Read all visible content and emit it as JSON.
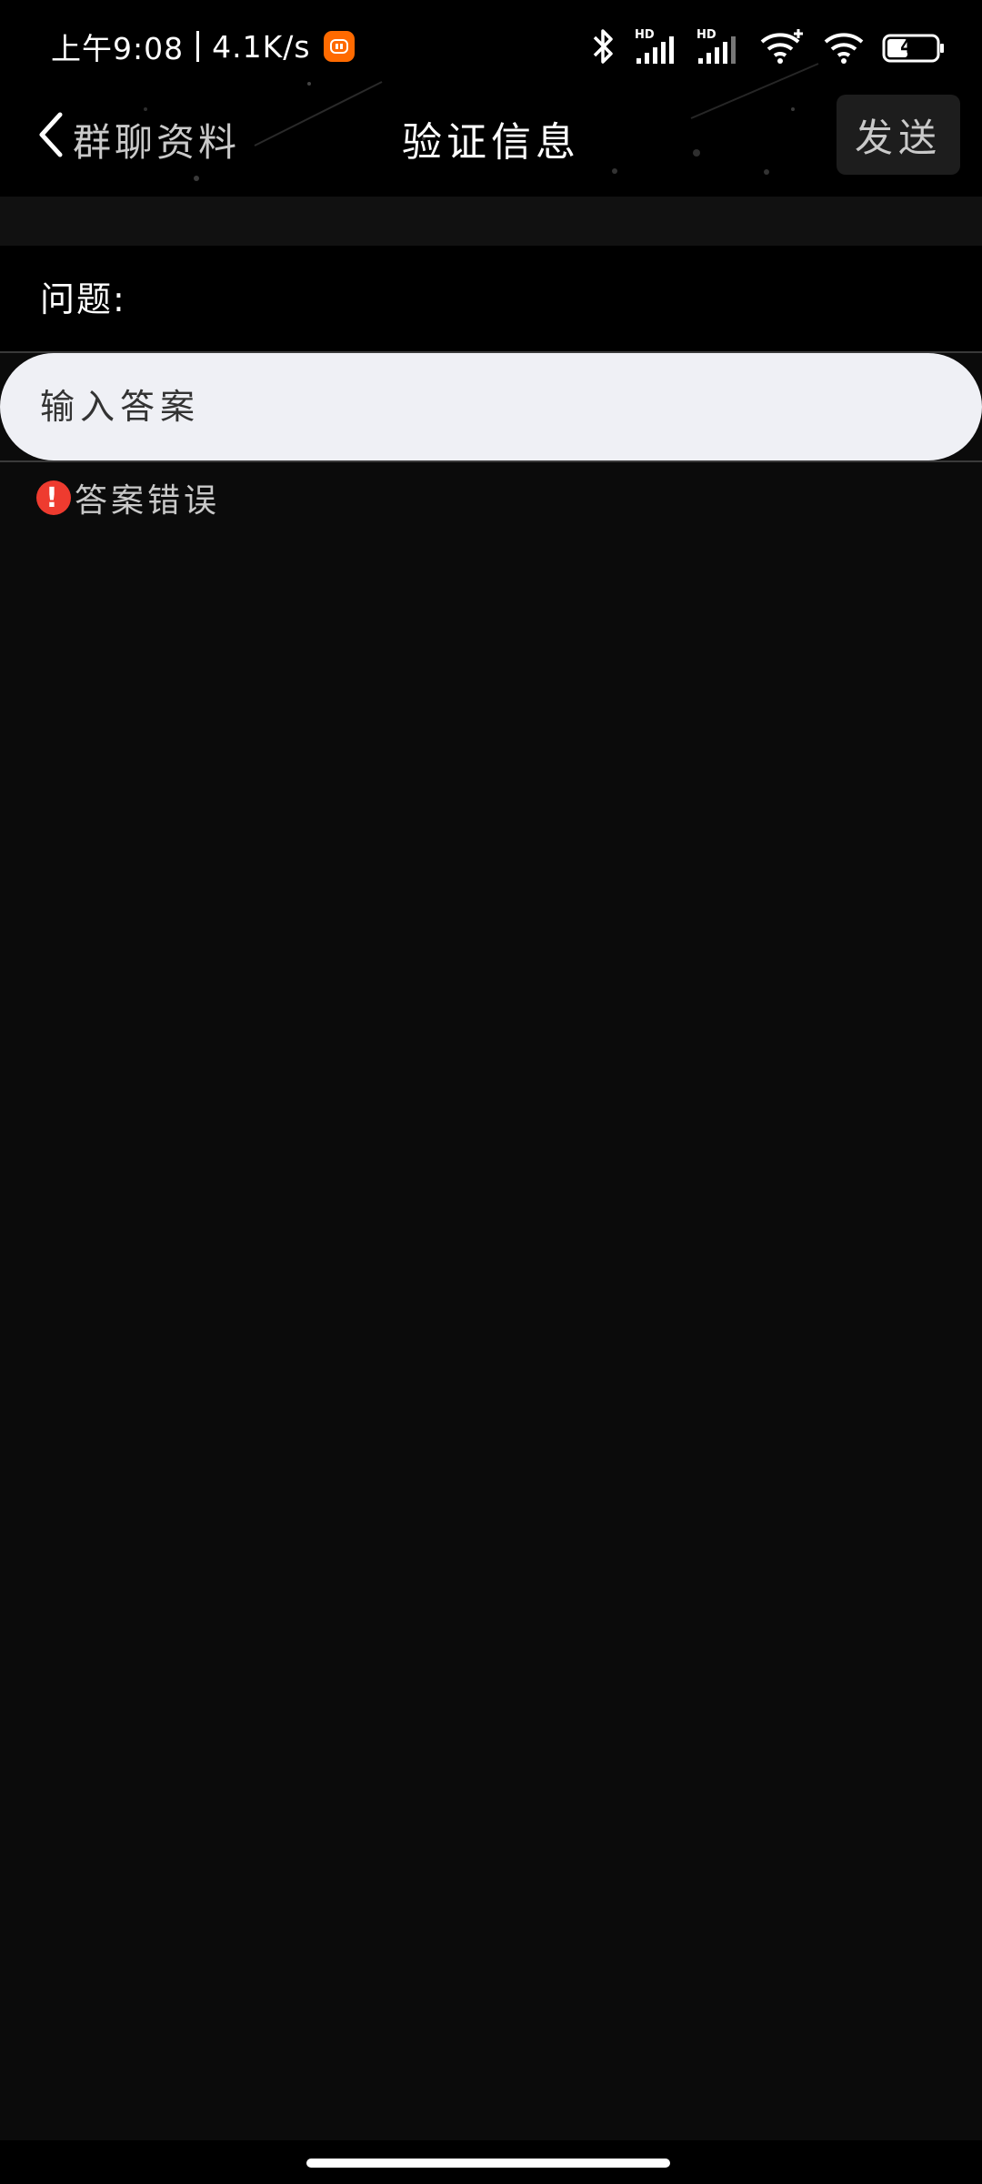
{
  "status_bar": {
    "time": "上午9:08",
    "net_speed": "4.1K/s",
    "battery": "41"
  },
  "nav": {
    "back_label": "群聊资料",
    "title": "验证信息",
    "send_label": "发送"
  },
  "form": {
    "question_label": "问题:",
    "answer_placeholder": "输入答案",
    "answer_value": "",
    "error_text": "答案错误"
  },
  "icons": {
    "back": "chevron-left-icon",
    "error": "exclamation-icon",
    "bluetooth": "bluetooth-icon",
    "signal": "signal-icon",
    "wifi": "wifi-icon",
    "battery": "battery-icon",
    "app": "mi-app-icon"
  },
  "colors": {
    "error": "#ee3b2f",
    "input_bg": "#eff0f5",
    "app_badge": "#ff6a00"
  }
}
